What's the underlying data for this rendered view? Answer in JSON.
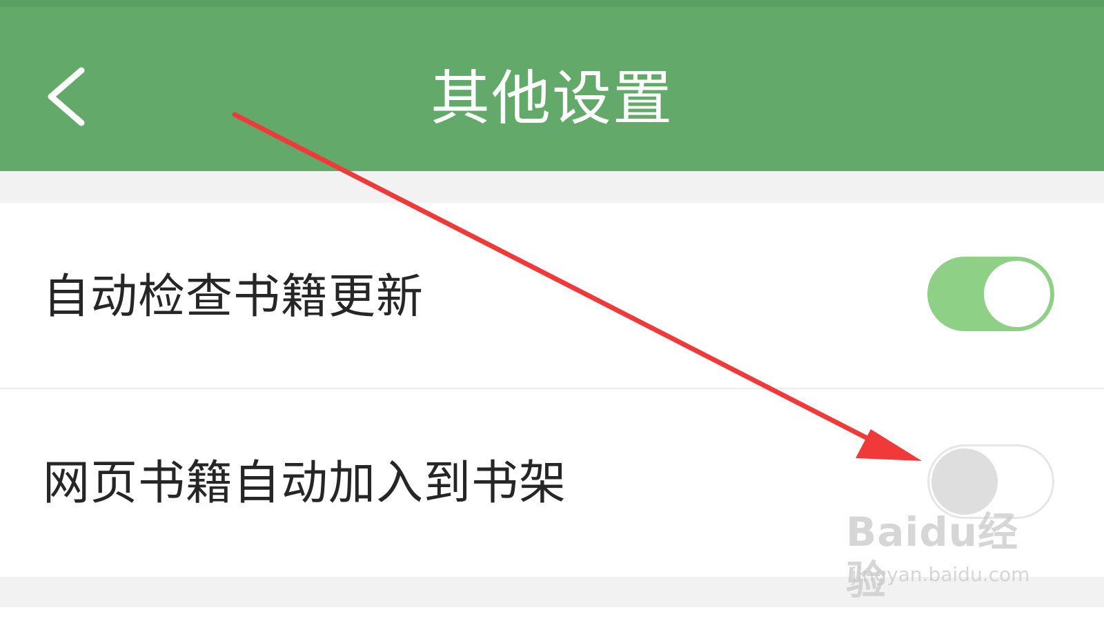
{
  "header": {
    "title": "其他设置",
    "background_color": "#63a96a",
    "back_icon": "chevron-left-icon"
  },
  "settings": {
    "items": [
      {
        "label": "自动检查书籍更新",
        "enabled": true
      },
      {
        "label": "网页书籍自动加入到书架",
        "enabled": false
      }
    ],
    "toggle_on_color": "#8fd087",
    "toggle_off_color": "#dedede"
  },
  "annotation": {
    "arrow_color": "#f03a3a",
    "arrow_icon": "red-arrow-annotation"
  },
  "watermark": {
    "logo_text": "Baidu经验",
    "url": "jingyan.baidu.com"
  }
}
